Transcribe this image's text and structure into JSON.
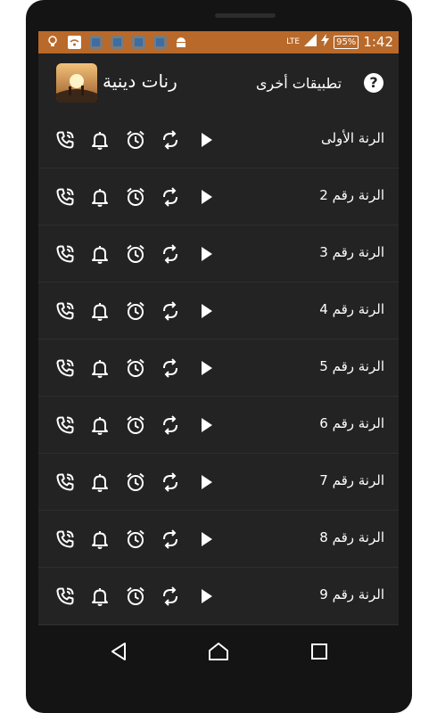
{
  "status_bar": {
    "network": "LTE",
    "battery": "95%",
    "time": "1:42",
    "left_icons": [
      "bulb-icon",
      "wifi-app-icon",
      "app-icon",
      "app-icon",
      "app-icon",
      "app-icon",
      "android-icon"
    ]
  },
  "app_bar": {
    "title": "رنات دينية",
    "other_apps": "تطبيقات أخرى",
    "help_label": "?"
  },
  "ringtones": [
    {
      "label": "الرنة الأولى"
    },
    {
      "label": "الرنة رقم 2"
    },
    {
      "label": "الرنة رقم 3"
    },
    {
      "label": "الرنة رقم 4"
    },
    {
      "label": "الرنة رقم 5"
    },
    {
      "label": "الرنة رقم 6"
    },
    {
      "label": "الرنة رقم 7"
    },
    {
      "label": "الرنة رقم 8"
    },
    {
      "label": "الرنة رقم 9"
    }
  ],
  "row_actions": [
    "phone-ringtone-icon",
    "bell-icon",
    "alarm-clock-icon",
    "repeat-icon",
    "play-icon"
  ],
  "colors": {
    "status_bar": "#b9692a",
    "background": "#232323",
    "icon": "#ffffff"
  }
}
